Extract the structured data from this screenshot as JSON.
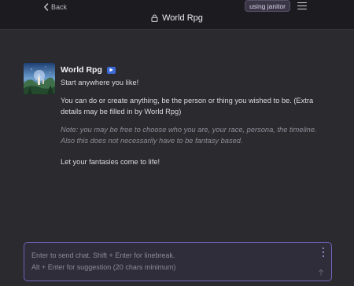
{
  "header": {
    "back_label": "Back",
    "title": "World Rpg",
    "janitor_label": "using janitor",
    "icons": {
      "back": "chevron-left-icon",
      "lock": "lock-icon",
      "menu": "hamburger-menu-icon"
    }
  },
  "message": {
    "character_name": "World Rpg",
    "badge_icon": "bot-badge-icon",
    "paragraphs": [
      "Start anywhere you like!",
      "You can do or create anything, be the person or thing you wished to be. (Extra details may be filled in by World Rpg)",
      "Note: you may be free to choose who you are, your race, persona, the timeline. Also this does not necessarily have to be fantasy based.",
      "Let your fantasies come to life!"
    ]
  },
  "composer": {
    "placeholder": "Enter to send chat. Shift + Enter for linebreak.\nAlt + Enter for suggestion (20 chars minimum)",
    "value": "",
    "icons": {
      "more": "more-vertical-icon",
      "send": "send-arrow-icon"
    }
  },
  "colors": {
    "background": "#2b2a2f",
    "topbar": "#1c1b20",
    "accent": "#6e63b8",
    "badge": "#3c69d6"
  }
}
